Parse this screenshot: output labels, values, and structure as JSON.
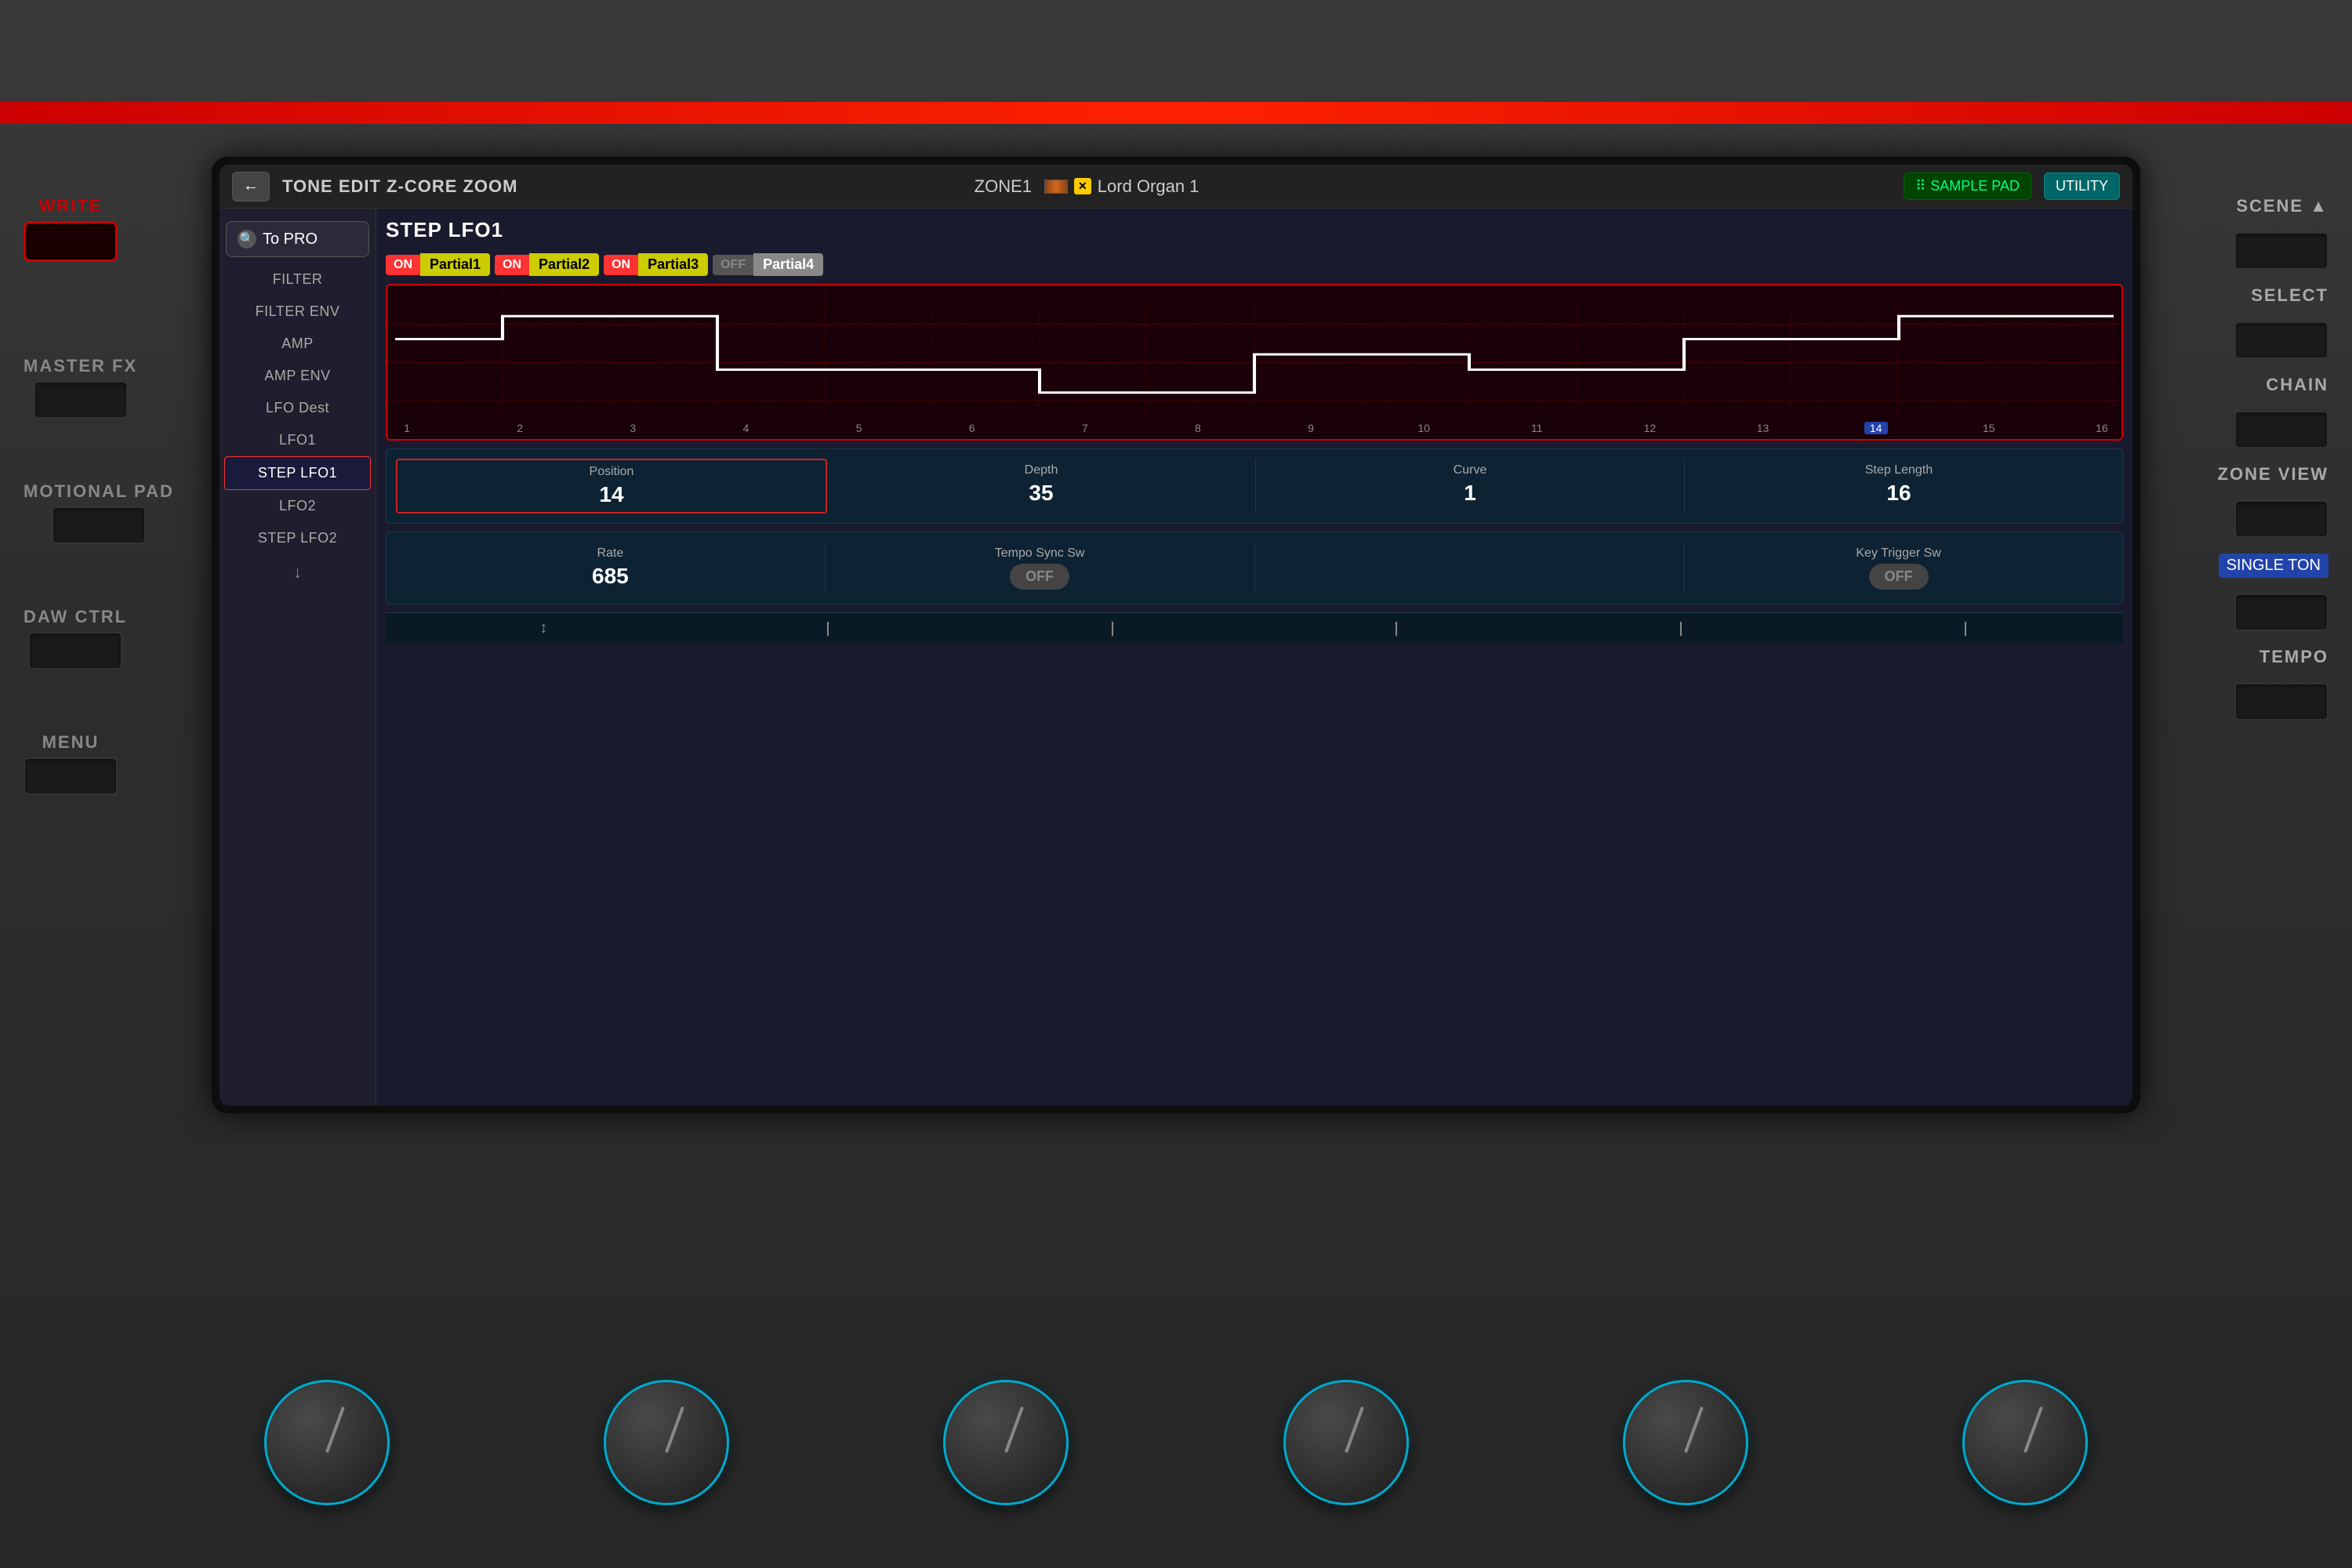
{
  "device": {
    "red_stripe_label": ""
  },
  "header": {
    "back_arrow": "←",
    "title": "TONE EDIT Z-CORE ZOOM",
    "zone": "ZONE1",
    "instrument_name": "Lord Organ 1",
    "sample_pad_label": "SAMPLE PAD",
    "utility_label": "UTILITY"
  },
  "sidebar": {
    "to_pro_label": "To PRO",
    "items": [
      {
        "label": "FILTER",
        "active": false
      },
      {
        "label": "FILTER ENV",
        "active": false
      },
      {
        "label": "AMP",
        "active": false
      },
      {
        "label": "AMP ENV",
        "active": false
      },
      {
        "label": "LFO Dest",
        "active": false
      },
      {
        "label": "LFO1",
        "active": false
      },
      {
        "label": "STEP LFO1",
        "active": true
      },
      {
        "label": "LFO2",
        "active": false
      },
      {
        "label": "STEP LFO2",
        "active": false
      }
    ],
    "down_arrow": "↓"
  },
  "main": {
    "section_title": "STEP LFO1",
    "partials": [
      {
        "on_state": "ON",
        "name": "Partial1",
        "on": true,
        "color": "yellow"
      },
      {
        "on_state": "ON",
        "name": "Partial2",
        "on": true,
        "color": "yellow"
      },
      {
        "on_state": "ON",
        "name": "Partial3",
        "on": true,
        "color": "yellow"
      },
      {
        "on_state": "OFF",
        "name": "Partial4",
        "on": false,
        "color": "gray"
      }
    ],
    "waveform": {
      "step_count": 16,
      "active_step": 14,
      "steps": [
        8,
        10,
        10,
        4,
        4,
        4,
        2,
        2,
        6,
        6,
        4,
        4,
        8,
        8,
        10,
        10
      ]
    },
    "params_row1": [
      {
        "label": "Position",
        "value": "14",
        "highlighted": true
      },
      {
        "label": "Depth",
        "value": "35"
      },
      {
        "label": "Curve",
        "value": "1"
      },
      {
        "label": "Step Length",
        "value": "16"
      }
    ],
    "params_row2": [
      {
        "label": "Rate",
        "value": "685"
      },
      {
        "label": "Tempo Sync Sw",
        "value": "OFF",
        "is_toggle": true
      },
      {
        "label": "",
        "value": ""
      },
      {
        "label": "Key Trigger Sw",
        "value": "OFF",
        "is_toggle": true
      }
    ]
  },
  "indicator_bar": {
    "down_symbol": "↕",
    "lines": [
      "",
      "",
      "",
      "",
      ""
    ]
  },
  "left_labels": [
    {
      "label": "WRITE"
    },
    {
      "label": "MASTER FX"
    },
    {
      "label": "MOTIONAL\nPAD"
    },
    {
      "label": "DAW CTRL"
    },
    {
      "label": "MENU"
    }
  ],
  "right_labels": [
    {
      "label": "SCENE ▲"
    },
    {
      "label": "SELECT"
    },
    {
      "label": "CHAIN"
    },
    {
      "label": "ZONE VIEW"
    },
    {
      "label": "SINGLE TON"
    },
    {
      "label": "TEMPO"
    }
  ],
  "knobs": [
    {
      "id": "knob1"
    },
    {
      "id": "knob2"
    },
    {
      "id": "knob3"
    },
    {
      "id": "knob4"
    },
    {
      "id": "knob5"
    },
    {
      "id": "knob6"
    }
  ]
}
